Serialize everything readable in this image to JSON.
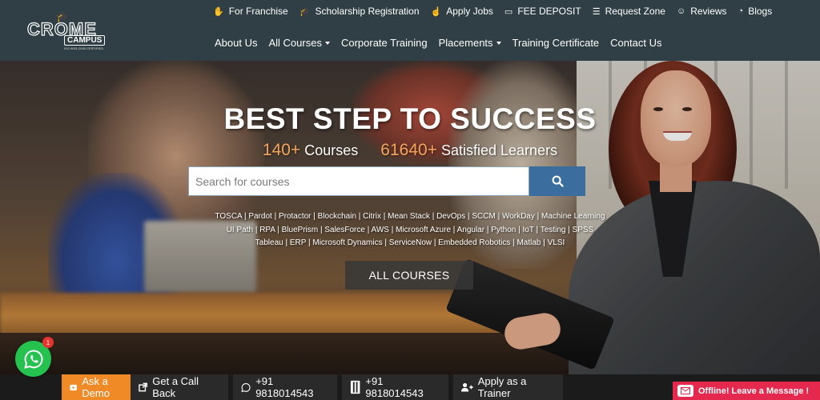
{
  "brand": {
    "logo_main": "CROME",
    "logo_sub": "CAMPUS",
    "logo_tag": "ISO 9001:2008 CERTIFIED"
  },
  "topbar": {
    "items": [
      {
        "label": "For Franchise",
        "icon": "handshake-icon"
      },
      {
        "label": "Scholarship Registration",
        "icon": "graduation-cap-icon"
      },
      {
        "label": "Apply Jobs",
        "icon": "hand-pointer-icon"
      },
      {
        "label": "FEE DEPOSIT",
        "icon": "credit-card-icon"
      },
      {
        "label": "Request Zone",
        "icon": "list-icon"
      },
      {
        "label": "Reviews",
        "icon": "smile-icon"
      },
      {
        "label": "Blogs",
        "icon": "rss-icon"
      }
    ]
  },
  "nav": {
    "about": "About Us",
    "courses": "All Courses",
    "corporate": "Corporate Training",
    "placements": "Placements",
    "certificate": "Training Certificate",
    "contact": "Contact Us"
  },
  "hero": {
    "title": "BEST STEP TO SUCCESS",
    "courses_count": "140+",
    "courses_label": "Courses",
    "learners_count": "61640+",
    "learners_label": "Satisfied Learners",
    "search_placeholder": "Search for courses",
    "tags_line1": "TOSCA | Pardot | Protactor | Blockchain | Citrix | Mean Stack | DevOps | SCCM | WorkDay | Machine Learning",
    "tags_line2": "UI Path | RPA | BluePrism | SalesForce | AWS | Microsoft Azure | Angular | Python | IoT | Testing | SPSS",
    "tags_line3": "Tableau | ERP | Microsoft Dynamics | ServiceNow | Embedded Robotics | Matlab | VLSI",
    "all_courses": "ALL COURSES"
  },
  "whatsapp": {
    "badge": "1"
  },
  "bottombar": {
    "demo": "Ask a Demo",
    "callback": "Get a Call Back",
    "whatsapp_phone": "+91 9818014543",
    "phone": "+91 9818014543",
    "trainer": "Apply as a Trainer",
    "offline": "Offline! Leave a Message !"
  },
  "colors": {
    "header_bg": "#2f3f45",
    "accent_orange": "#f5a65b",
    "search_btn": "#3b6e9e",
    "demo_btn": "#f08a26",
    "offline_btn": "#e5294e",
    "whatsapp_green": "#25c24f"
  }
}
